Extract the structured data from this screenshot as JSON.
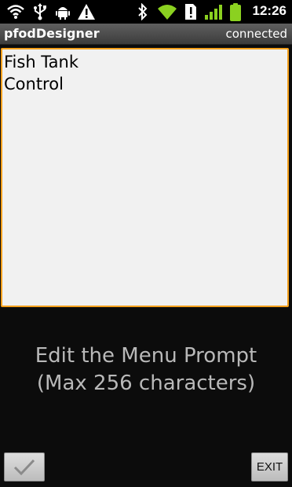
{
  "status_bar": {
    "time": "12:26",
    "icons": [
      "wifi-icon",
      "usb-icon",
      "android-debug-icon",
      "warning-icon",
      "bluetooth-icon",
      "wifi-signal-icon",
      "sim-alert-icon",
      "cell-signal-icon",
      "battery-icon"
    ]
  },
  "title_bar": {
    "app_name": "pfodDesigner",
    "connection_status": "connected"
  },
  "editor": {
    "value": "Fish Tank\nControl"
  },
  "prompt": {
    "line1": "Edit the Menu Prompt",
    "line2": "(Max 256 characters)"
  },
  "buttons": {
    "exit_label": "EXIT",
    "confirm_icon": "checkmark-icon"
  },
  "colors": {
    "accent": "#f4a01c",
    "battery": "#8bd120",
    "signal": "#8bd120"
  }
}
